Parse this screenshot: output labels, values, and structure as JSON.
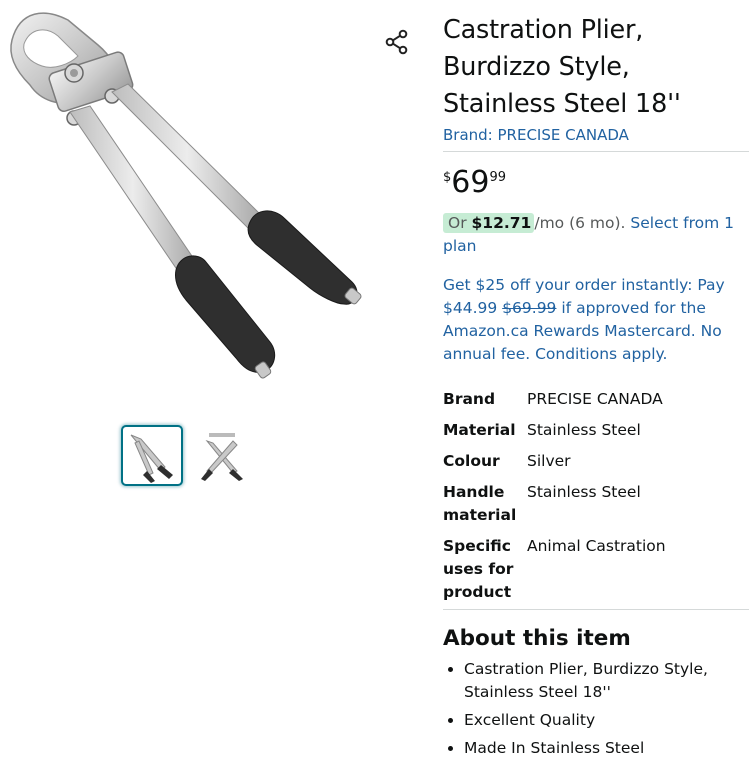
{
  "product": {
    "title": "Castration Plier, Burdizzo Style, Stainless Steel 18''",
    "brand_link": "Brand: PRECISE CANADA"
  },
  "price": {
    "currency_symbol": "$",
    "whole": "69",
    "fraction": "99"
  },
  "installment": {
    "prefix": "Or",
    "amount": "$12.71",
    "term": "/mo (6 mo).",
    "link": "Select from 1 plan"
  },
  "offer": {
    "lead": "Get $25 off your order instantly: Pay",
    "new_price": "$44.99",
    "old_price": "$69.99",
    "tail": "if approved for the Amazon.ca Rewards Mastercard. No annual fee. Conditions apply."
  },
  "specs": [
    {
      "key": "Brand",
      "value": "PRECISE CANADA"
    },
    {
      "key": "Material",
      "value": "Stainless Steel"
    },
    {
      "key": "Colour",
      "value": "Silver"
    },
    {
      "key": "Handle material",
      "value": "Stainless Steel"
    },
    {
      "key": "Specific uses for product",
      "value": "Animal Castration"
    }
  ],
  "about": {
    "title": "About this item",
    "bullets": [
      "Castration Plier, Burdizzo Style, Stainless Steel 18''",
      "Excellent Quality",
      "Made In Stainless Steel"
    ]
  },
  "icons": {
    "share": "share-icon"
  },
  "colors": {
    "link": "#2162a1",
    "text": "#0f1111",
    "badge_bg": "#c6ecd4",
    "thumb_border": "#007185"
  }
}
